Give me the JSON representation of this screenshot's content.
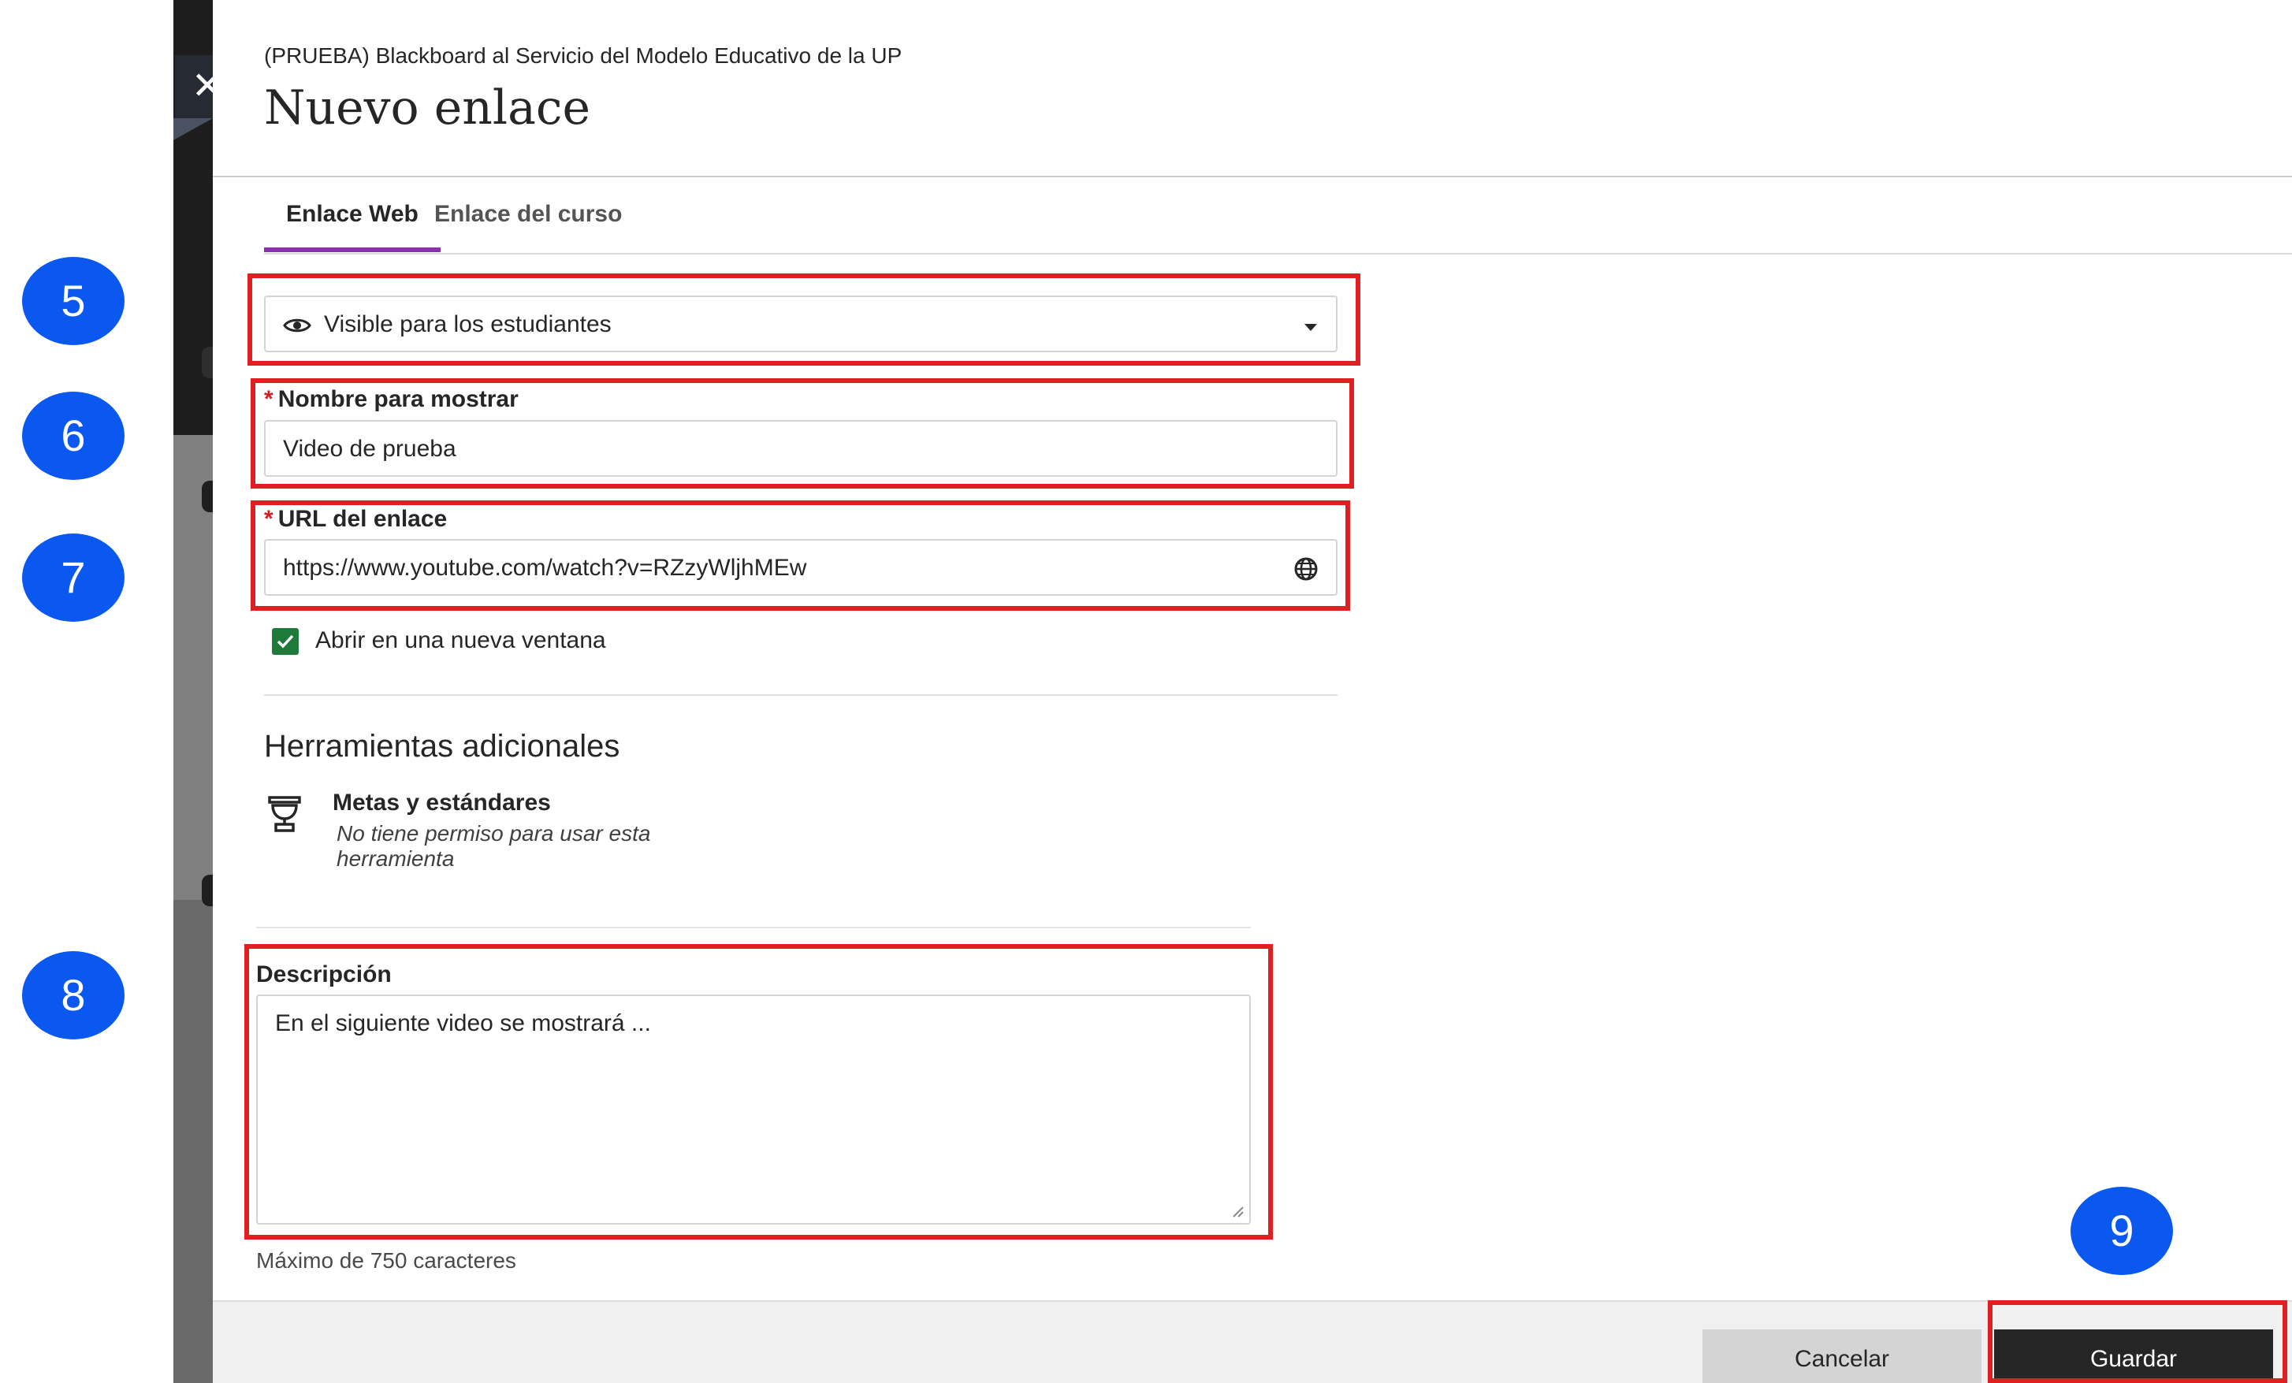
{
  "course_name": "(PRUEBA) Blackboard al Servicio del Modelo Educativo de la UP",
  "page_title": "Nuevo enlace",
  "close_icon": "close-icon",
  "tabs": [
    {
      "label": "Enlace Web",
      "active": true
    },
    {
      "label": "Enlace del curso",
      "active": false
    }
  ],
  "visibility": {
    "icon": "eye-icon",
    "value": "Visible para los estudiantes"
  },
  "display_name": {
    "required_mark": "*",
    "label": "Nombre para mostrar",
    "value": "Video de prueba"
  },
  "link_url": {
    "required_mark": "*",
    "label": "URL del enlace",
    "value": "https://www.youtube.com/watch?v=RZzyWljhMEw",
    "icon": "globe-icon"
  },
  "open_new_window": {
    "label": "Abrir en una nueva ventana",
    "checked": true
  },
  "additional_tools": {
    "title": "Herramientas adicionales",
    "goals": {
      "icon": "trophy-icon",
      "title": "Metas y estándares",
      "note": "No tiene permiso para usar esta herramienta"
    }
  },
  "description": {
    "label": "Descripción",
    "value": "En el siguiente video se mostrará ...",
    "max_chars": "Máximo de 750 caracteres"
  },
  "footer": {
    "cancel_label": "Cancelar",
    "save_label": "Guardar"
  },
  "callouts": [
    "5",
    "6",
    "7",
    "8",
    "9"
  ],
  "colors": {
    "accent_tab": "#8a2fad",
    "highlight": "#e02020",
    "callout": "#0a58f0",
    "checkbox": "#1d7a3a",
    "save_button": "#262626"
  }
}
